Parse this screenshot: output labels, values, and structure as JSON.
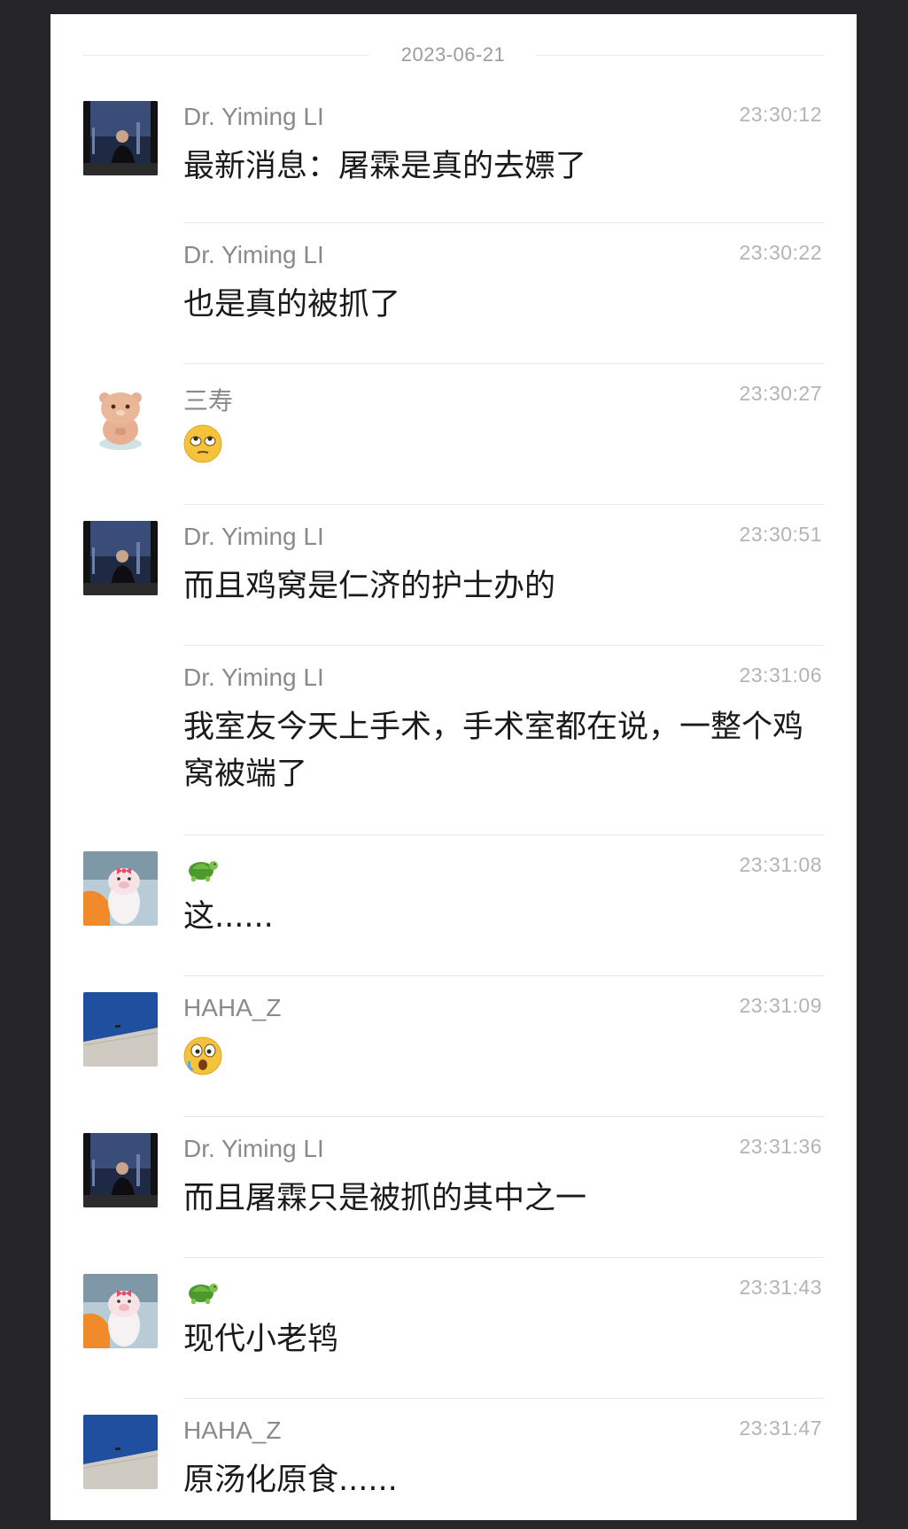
{
  "date": "2023-06-21",
  "messages": [
    {
      "sender": "Dr. Yiming LI",
      "time": "23:30:12",
      "text": "最新消息：屠霖是真的去嫖了"
    },
    {
      "sender": "Dr. Yiming LI",
      "time": "23:30:22",
      "text": "也是真的被抓了"
    },
    {
      "sender": "三寿",
      "time": "23:30:27",
      "emoji": "rolling-eyes-emoji"
    },
    {
      "sender": "Dr. Yiming LI",
      "time": "23:30:51",
      "text": "而且鸡窝是仁济的护士办的"
    },
    {
      "sender": "Dr. Yiming LI",
      "time": "23:31:06",
      "text": "我室友今天上手术，手术室都在说，一整个鸡窝被端了"
    },
    {
      "sender_icon": "turtle-emoji",
      "time": "23:31:08",
      "text": "这......"
    },
    {
      "sender": "HAHA_Z",
      "time": "23:31:09",
      "emoji": "shocked-face-emoji"
    },
    {
      "sender": "Dr. Yiming LI",
      "time": "23:31:36",
      "text": "而且屠霖只是被抓的其中之一"
    },
    {
      "sender_icon": "turtle-emoji",
      "time": "23:31:43",
      "text": "现代小老鸨"
    },
    {
      "sender": "HAHA_Z",
      "time": "23:31:47",
      "text": "原汤化原食......"
    }
  ]
}
